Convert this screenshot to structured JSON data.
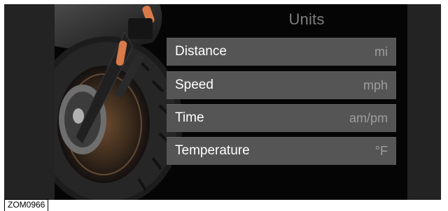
{
  "screen": {
    "title": "Units",
    "rows": [
      {
        "label": "Distance",
        "value": "mi"
      },
      {
        "label": "Speed",
        "value": "mph"
      },
      {
        "label": "Time",
        "value": "am/pm"
      },
      {
        "label": "Temperature",
        "value": "°F"
      }
    ]
  },
  "figure": {
    "caption": "ZOM0966"
  },
  "colors": {
    "row_background": "#555555",
    "screen_background": "#050505",
    "accent_reflector": "#d97a4a"
  }
}
